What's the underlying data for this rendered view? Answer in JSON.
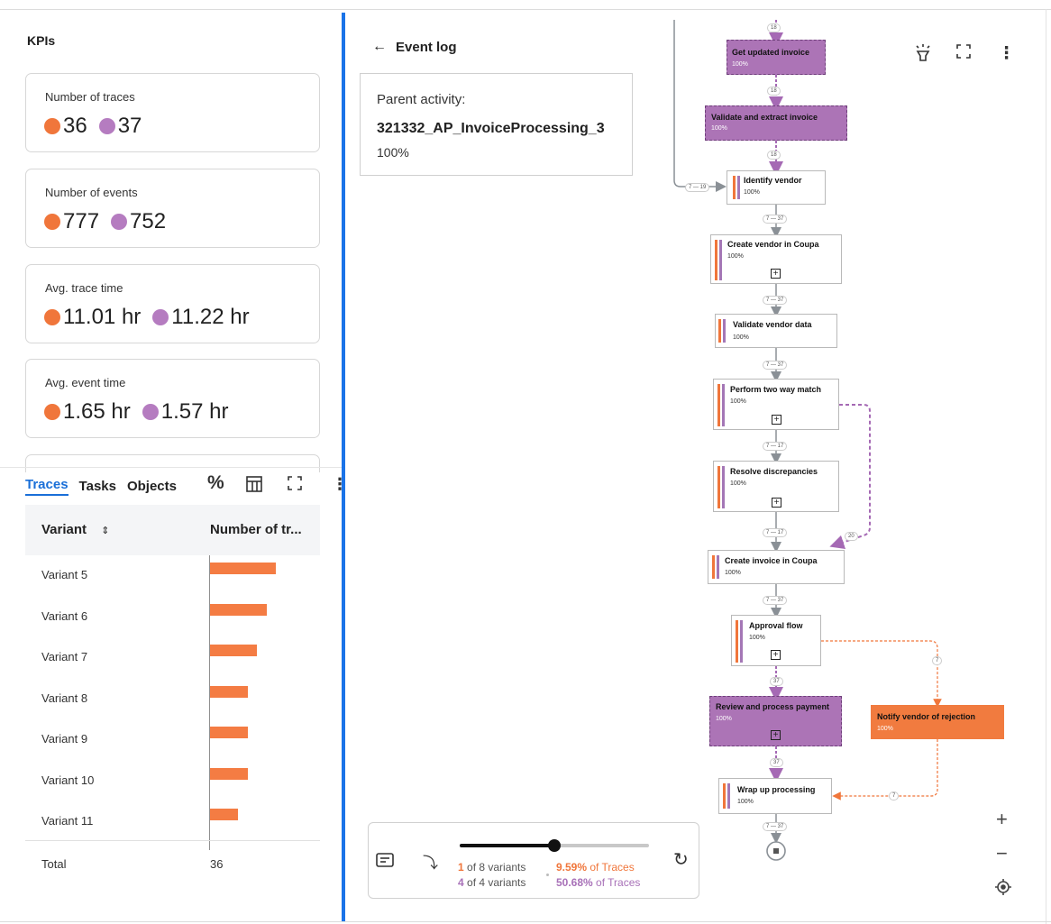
{
  "kpis": {
    "title": "KPIs",
    "cards": [
      {
        "label": "Number of traces",
        "value_a": "36",
        "value_b": "37"
      },
      {
        "label": "Number of events",
        "value_a": "777",
        "value_b": "752"
      },
      {
        "label": "Avg. trace time",
        "value_a": "11.01 hr",
        "value_b": "11.22 hr"
      },
      {
        "label": "Avg. event time",
        "value_a": "1.65 hr",
        "value_b": "1.57 hr"
      }
    ]
  },
  "colors": {
    "series_a": "#f0763b",
    "series_b": "#b57cc0",
    "accent": "#1a73e8"
  },
  "tabs": [
    {
      "label": "Traces",
      "active": true
    },
    {
      "label": "Tasks",
      "active": false
    },
    {
      "label": "Objects",
      "active": false
    }
  ],
  "toolbar_icons": [
    "percent-icon",
    "columns-icon",
    "expand-icon",
    "more-icon"
  ],
  "table": {
    "col_variant": "Variant",
    "col_count": "Number of tr...",
    "rows": [
      {
        "label": "Variant 5",
        "value": 7
      },
      {
        "label": "Variant 6",
        "value": 6
      },
      {
        "label": "Variant 7",
        "value": 5
      },
      {
        "label": "Variant 8",
        "value": 4
      },
      {
        "label": "Variant 9",
        "value": 4
      },
      {
        "label": "Variant 10",
        "value": 4
      },
      {
        "label": "Variant 11",
        "value": 3
      }
    ],
    "total_label": "Total",
    "total_value": "36"
  },
  "detail": {
    "back_label": "Event log",
    "parent_label": "Parent activity:",
    "parent_name": "321332_AP_InvoiceProcessing_3",
    "parent_pct": "100%"
  },
  "process": {
    "nodes": [
      {
        "name": "Get updated invoice",
        "pct": "100%"
      },
      {
        "name": "Validate and extract invoice",
        "pct": "100%"
      },
      {
        "name": "Identify vendor",
        "pct": "100%"
      },
      {
        "name": "Create vendor in Coupa",
        "pct": "100%"
      },
      {
        "name": "Validate vendor data",
        "pct": "100%"
      },
      {
        "name": "Perform two way match",
        "pct": "100%"
      },
      {
        "name": "Resolve discrepancies",
        "pct": "100%"
      },
      {
        "name": "Create invoice in Coupa",
        "pct": "100%"
      },
      {
        "name": "Approval flow",
        "pct": "100%"
      },
      {
        "name": "Review and process payment",
        "pct": "100%"
      },
      {
        "name": "Notify vendor of rejection",
        "pct": "100%"
      },
      {
        "name": "Wrap up processing",
        "pct": "100%"
      }
    ],
    "edge_labels": {
      "top": "18",
      "e1": "18",
      "e2": "18",
      "loop": "7 — 19",
      "e3": "7 — 37",
      "e4": "7 — 37",
      "e5": "7 — 37",
      "e6": "7 — 17",
      "e7": "7 — 17",
      "dash20": "20",
      "e8": "7 — 37",
      "e9": "37",
      "e10": "37",
      "rej": "7",
      "rej2": "7",
      "end": "7 — 37"
    }
  },
  "variants": {
    "slider_fraction": 0.5,
    "a_count": "1",
    "a_text": " of 8 variants",
    "a_pct": "9.59%",
    "a_pct_text": " of Traces",
    "b_count": "4",
    "b_text": " of 4 variants",
    "b_pct": "50.68%",
    "b_pct_text": " of Traces"
  }
}
